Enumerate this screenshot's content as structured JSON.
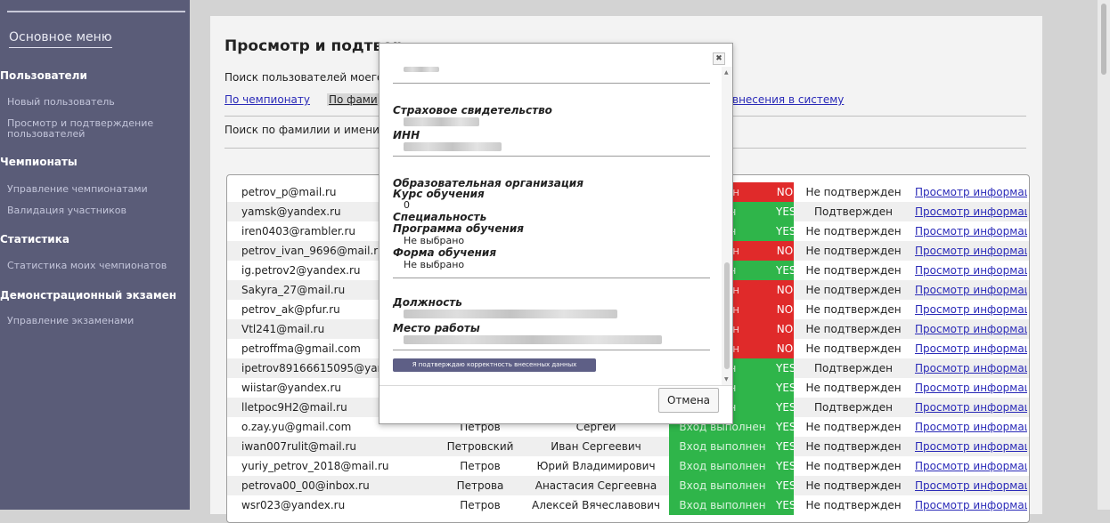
{
  "sidebar": {
    "title": "Основное меню",
    "sections": [
      {
        "label": "Пользователи",
        "items": [
          "Новый пользователь",
          "Просмотр и подтверждение пользователей"
        ]
      },
      {
        "label": "Чемпионаты",
        "items": [
          "Управление чемпионатами",
          "Валидация участников"
        ]
      },
      {
        "label": "Статистика",
        "items": [
          "Статистика моих чемпионатов"
        ]
      },
      {
        "label": "Демонстрационный экзамен",
        "items": [
          "Управление экзаменами"
        ]
      }
    ]
  },
  "main": {
    "title": "Просмотр и подтвер",
    "subtitle": "Поиск пользователей моего",
    "nav": [
      "По чемпионату",
      "По фами",
      "внесения в систему"
    ],
    "search_label": "Поиск по фамилии и имени"
  },
  "table": {
    "rows": [
      {
        "email": "petrov_p@mail.ru",
        "last": "",
        "first": "",
        "login": "олнен",
        "flag": "NO",
        "status": "Не подтвержден",
        "link": "Просмотр информации"
      },
      {
        "email": "yamsk@yandex.ru",
        "last": "",
        "first": "",
        "login": "лнен",
        "flag": "YES",
        "status": "Подтвержден",
        "link": "Просмотр информации"
      },
      {
        "email": "iren0403@rambler.ru",
        "last": "",
        "first": "",
        "login": "лнен",
        "flag": "YES",
        "status": "Не подтвержден",
        "link": "Просмотр информации"
      },
      {
        "email": "petrov_ivan_9696@mail.ru",
        "last": "",
        "first": "",
        "login": "олнен",
        "flag": "NO",
        "status": "Не подтвержден",
        "link": "Просмотр информации"
      },
      {
        "email": "ig.petrov2@yandex.ru",
        "last": "",
        "first": "",
        "login": "лнен",
        "flag": "YES",
        "status": "Не подтвержден",
        "link": "Просмотр информации"
      },
      {
        "email": "Sakyra_27@mail.ru",
        "last": "",
        "first": "",
        "login": "олнен",
        "flag": "NO",
        "status": "Не подтвержден",
        "link": "Просмотр информации"
      },
      {
        "email": "petrov_ak@pfur.ru",
        "last": "",
        "first": "",
        "login": "олнен",
        "flag": "NO",
        "status": "Не подтвержден",
        "link": "Просмотр информации"
      },
      {
        "email": "Vtl241@mail.ru",
        "last": "",
        "first": "",
        "login": "олнен",
        "flag": "NO",
        "status": "Не подтвержден",
        "link": "Просмотр информации"
      },
      {
        "email": "petroffma@gmail.com",
        "last": "",
        "first": "",
        "login": "олнен",
        "flag": "NO",
        "status": "Не подтвержден",
        "link": "Просмотр информации"
      },
      {
        "email": "ipetrov89166615095@yand",
        "last": "",
        "first": "",
        "login": "лнен",
        "flag": "YES",
        "status": "Подтвержден",
        "link": "Просмотр информации"
      },
      {
        "email": "wiistar@yandex.ru",
        "last": "",
        "first": "",
        "login": "лнен",
        "flag": "YES",
        "status": "Не подтвержден",
        "link": "Просмотр информации"
      },
      {
        "email": "lletpoc9H2@mail.ru",
        "last": "",
        "first": "",
        "login": "лнен",
        "flag": "YES",
        "status": "Подтвержден",
        "link": "Просмотр информации"
      },
      {
        "email": "o.zay.yu@gmail.com",
        "last": "Петров",
        "first": "Сергей",
        "login": "Вход выполнен",
        "flag": "YES",
        "status": "Не подтвержден",
        "link": "Просмотр информации"
      },
      {
        "email": "iwan007rulit@mail.ru",
        "last": "Петровский",
        "first": "Иван Сергеевич",
        "login": "Вход выполнен",
        "flag": "YES",
        "status": "Не подтвержден",
        "link": "Просмотр информации"
      },
      {
        "email": "yuriy_petrov_2018@mail.ru",
        "last": "Петров",
        "first": "Юрий Владимирович",
        "login": "Вход выполнен",
        "flag": "YES",
        "status": "Не подтвержден",
        "link": "Просмотр информации"
      },
      {
        "email": "petrova00_00@inbox.ru",
        "last": "Петрова",
        "first": "Анастасия Сергеевна",
        "login": "Вход выполнен",
        "flag": "YES",
        "status": "Не подтвержден",
        "link": "Просмотр информации"
      },
      {
        "email": "wsr023@yandex.ru",
        "last": "Петров",
        "first": "Алексей Вячеславович",
        "login": "Вход выполнен",
        "flag": "YES",
        "status": "Не подтвержден",
        "link": "Просмотр информации"
      }
    ]
  },
  "modal": {
    "close_icon": "close-icon",
    "fields": {
      "insurance_label": "Страховое свидетельство",
      "inn_label": "ИНН",
      "edu_org_label": "Образовательная организация",
      "course_label": "Курс обучения",
      "course_value": "0",
      "specialty_label": "Специальность",
      "program_label": "Программа обучения",
      "program_value": "Не выбрано",
      "form_label": "Форма обучения",
      "form_value": "Не выбрано",
      "position_label": "Должность",
      "workplace_label": "Место работы"
    },
    "confirm_label": "Я подтверждаю корректность внесенных данных",
    "cancel_label": "Отмена"
  }
}
